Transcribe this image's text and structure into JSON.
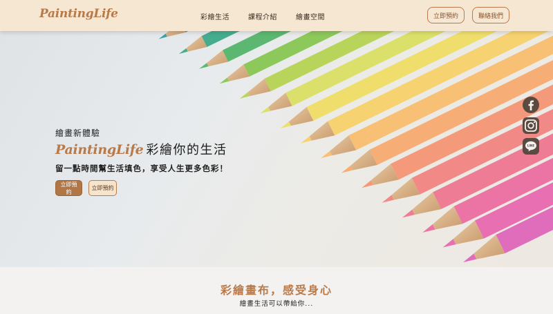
{
  "header": {
    "logo": "PaintingLife",
    "nav": [
      "彩繪生活",
      "課程介紹",
      "繪畫空間"
    ],
    "book_button": "立即預約",
    "contact_button": "聯絡我們"
  },
  "hero": {
    "kicker": "繪畫新體驗",
    "title_brand": "PaintingLife",
    "title_rest": "彩繪你的生活",
    "subtitle": "留一點時間幫生活填色，享受人生更多色彩！",
    "primary_button": "立即預約",
    "secondary_button": "立即預約"
  },
  "social": [
    "facebook-icon",
    "instagram-icon",
    "line-icon"
  ],
  "section": {
    "title": "彩繪畫布，感受身心",
    "subtitle": "繪畫生活可以帶給你..."
  },
  "colors": {
    "accent": "#b97a4a",
    "header_bg": "#f6e7d2",
    "social_icon": "#5a4a40"
  }
}
